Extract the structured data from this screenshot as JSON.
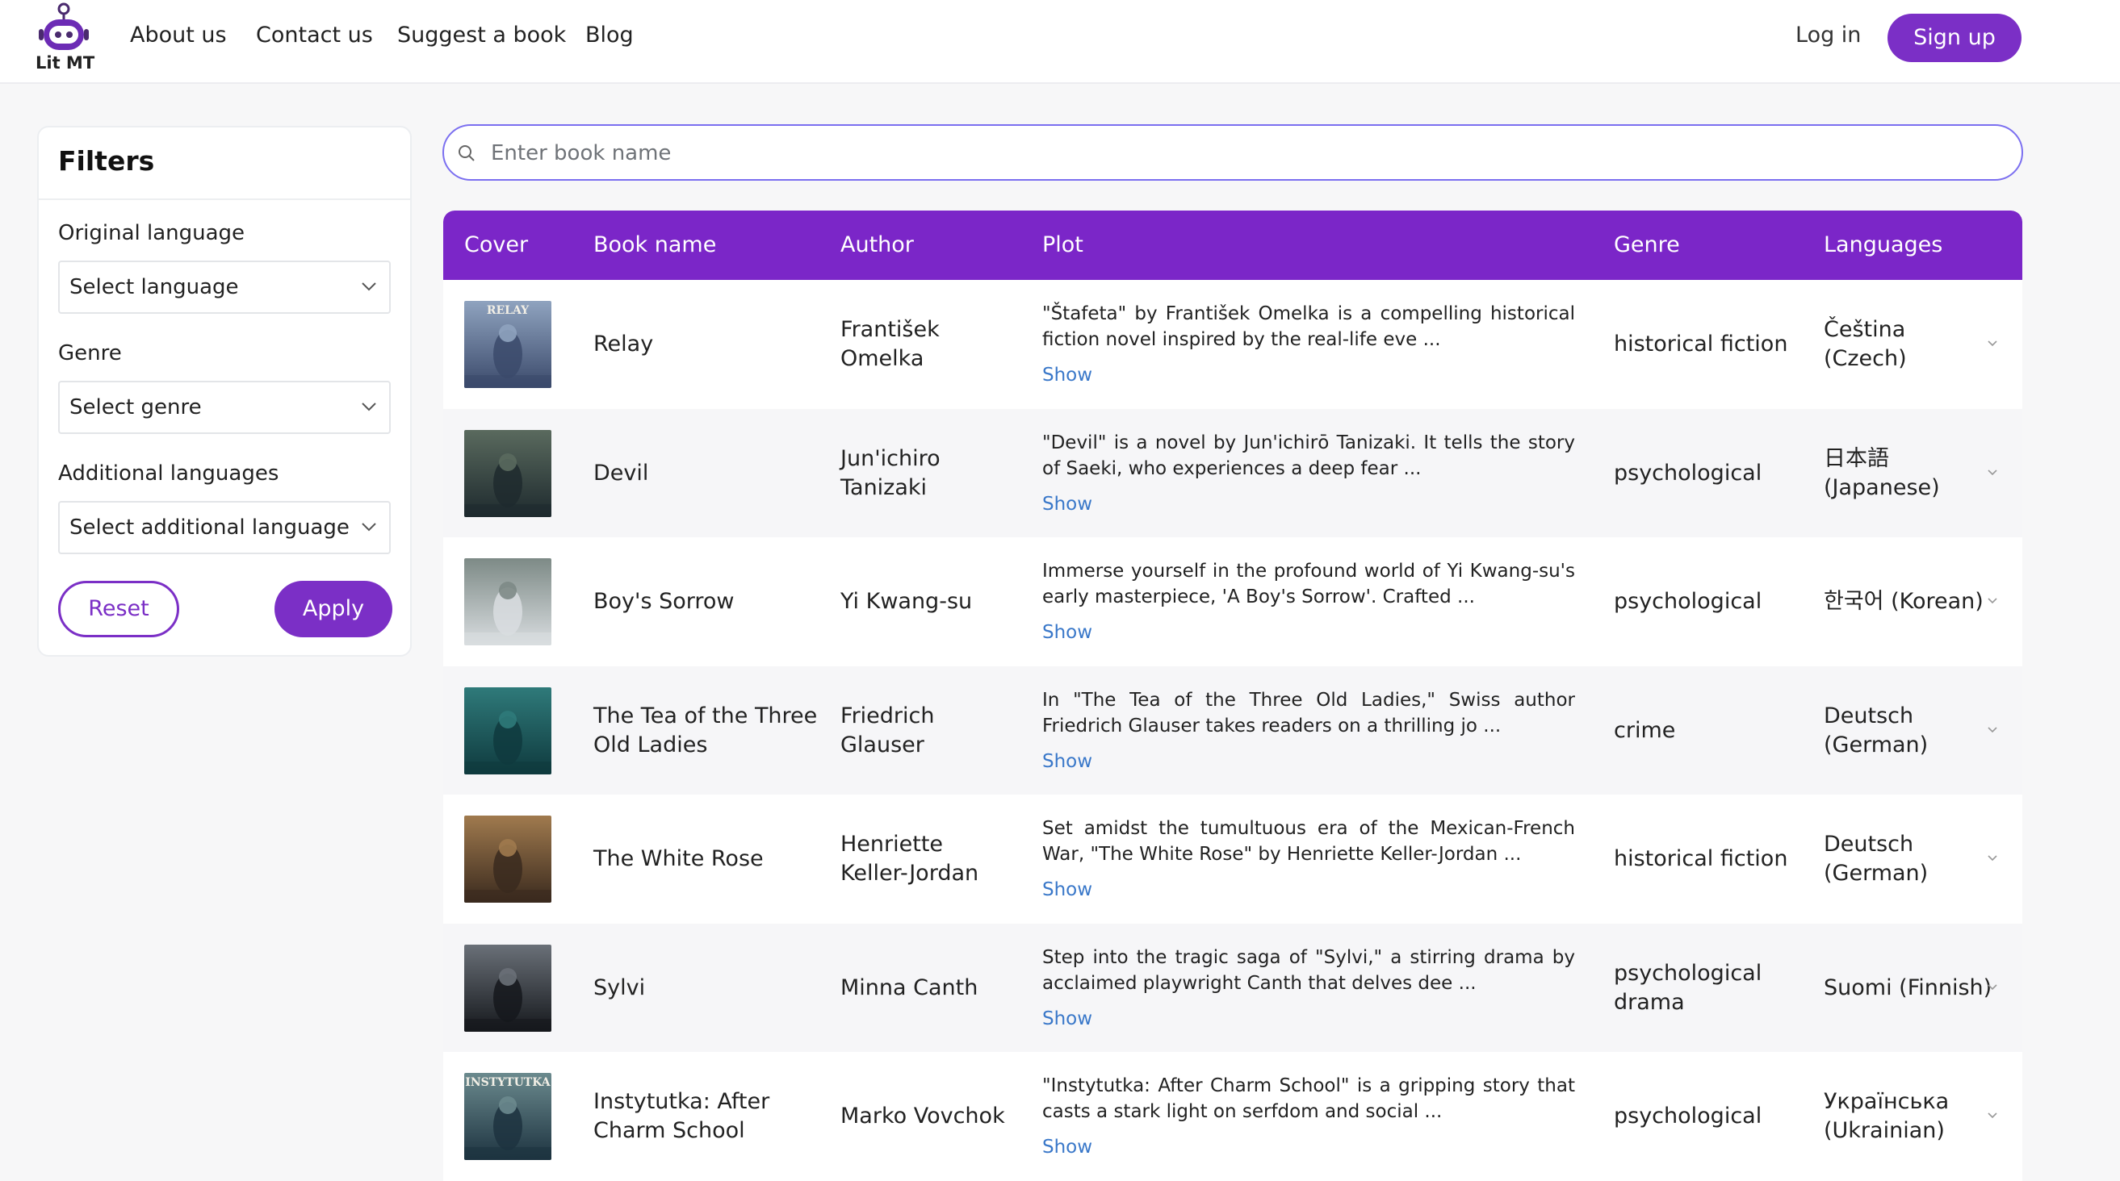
{
  "header": {
    "logo_text": "Lit MT",
    "nav": [
      "About us",
      "Contact us",
      "Suggest a book",
      "Blog"
    ],
    "login": "Log in",
    "signup": "Sign up"
  },
  "filters": {
    "title": "Filters",
    "original_language": {
      "label": "Original language",
      "value": "Select language"
    },
    "genre": {
      "label": "Genre",
      "value": "Select genre"
    },
    "additional_languages": {
      "label": "Additional languages",
      "value": "Select additional language"
    },
    "reset": "Reset",
    "apply": "Apply"
  },
  "search": {
    "placeholder": "Enter book name"
  },
  "table": {
    "headers": [
      "Cover",
      "Book name",
      "Author",
      "Plot",
      "Genre",
      "Languages"
    ],
    "show_label": "Show",
    "rows": [
      {
        "name": "Relay",
        "author": "František Omelka",
        "plot": "\"Štafeta\" by František Omelka is a compelling historical fiction novel inspired by the real-life eve ...",
        "genre": "historical fiction",
        "language": "Čeština (Czech)",
        "cover_text": "RELAY",
        "cover_colors": [
          "#3b4a6b",
          "#8fa3bf"
        ]
      },
      {
        "name": "Devil",
        "author": "Jun'ichiro Tanizaki",
        "plot": "\"Devil\" is a novel by Jun'ichirō Tanizaki. It tells the story of Saeki, who experiences a deep fear ...",
        "genre": "psychological",
        "language": "日本語 (Japanese)",
        "cover_text": "",
        "cover_colors": [
          "#1e2a2e",
          "#5a6a5e"
        ]
      },
      {
        "name": "Boy's Sorrow",
        "author": "Yi Kwang-su",
        "plot": "Immerse yourself in the profound world of Yi Kwang-su's early masterpiece, 'A Boy's Sorrow'. Crafted ...",
        "genre": "psychological",
        "language": "한국어 (Korean)",
        "cover_text": "",
        "cover_colors": [
          "#d9dde0",
          "#7d8a86"
        ]
      },
      {
        "name": "The Tea of the Three Old Ladies",
        "author": "Friedrich Glauser",
        "plot": "In \"The Tea of the Three Old Ladies,\" Swiss author Friedrich Glauser takes readers on a thrilling jo ...",
        "genre": "crime",
        "language": "Deutsch (German)",
        "cover_text": "",
        "cover_colors": [
          "#0f3a3e",
          "#2f7a7a"
        ]
      },
      {
        "name": "The White Rose",
        "author": "Henriette Keller-Jordan",
        "plot": "Set amidst the tumultuous era of the Mexican-French War, \"The White Rose\" by Henriette Keller-Jordan ...",
        "genre": "historical fiction",
        "language": "Deutsch (German)",
        "cover_text": "",
        "cover_colors": [
          "#3a2a1e",
          "#a07a4e"
        ]
      },
      {
        "name": "Sylvi",
        "author": "Minna Canth",
        "plot": "Step into the tragic saga of \"Sylvi,\" a stirring drama by acclaimed playwright Canth that delves dee ...",
        "genre": "psychological drama",
        "language": "Suomi (Finnish)",
        "cover_text": "",
        "cover_colors": [
          "#15181c",
          "#6a7078"
        ]
      },
      {
        "name": "Instytutka: After Charm School",
        "author": "Marko Vovchok",
        "plot": "\"Instytutka: After Charm School\" is a gripping story that casts a stark light on serfdom and social ...",
        "genre": "psychological",
        "language": "Українська (Ukrainian)",
        "cover_text": "INSTYTUTKA",
        "cover_colors": [
          "#1d3340",
          "#6b8a8e"
        ]
      }
    ]
  },
  "colors": {
    "accent": "#7b2fc6",
    "header_bg": "#7b26c8",
    "link": "#3a78c9"
  }
}
